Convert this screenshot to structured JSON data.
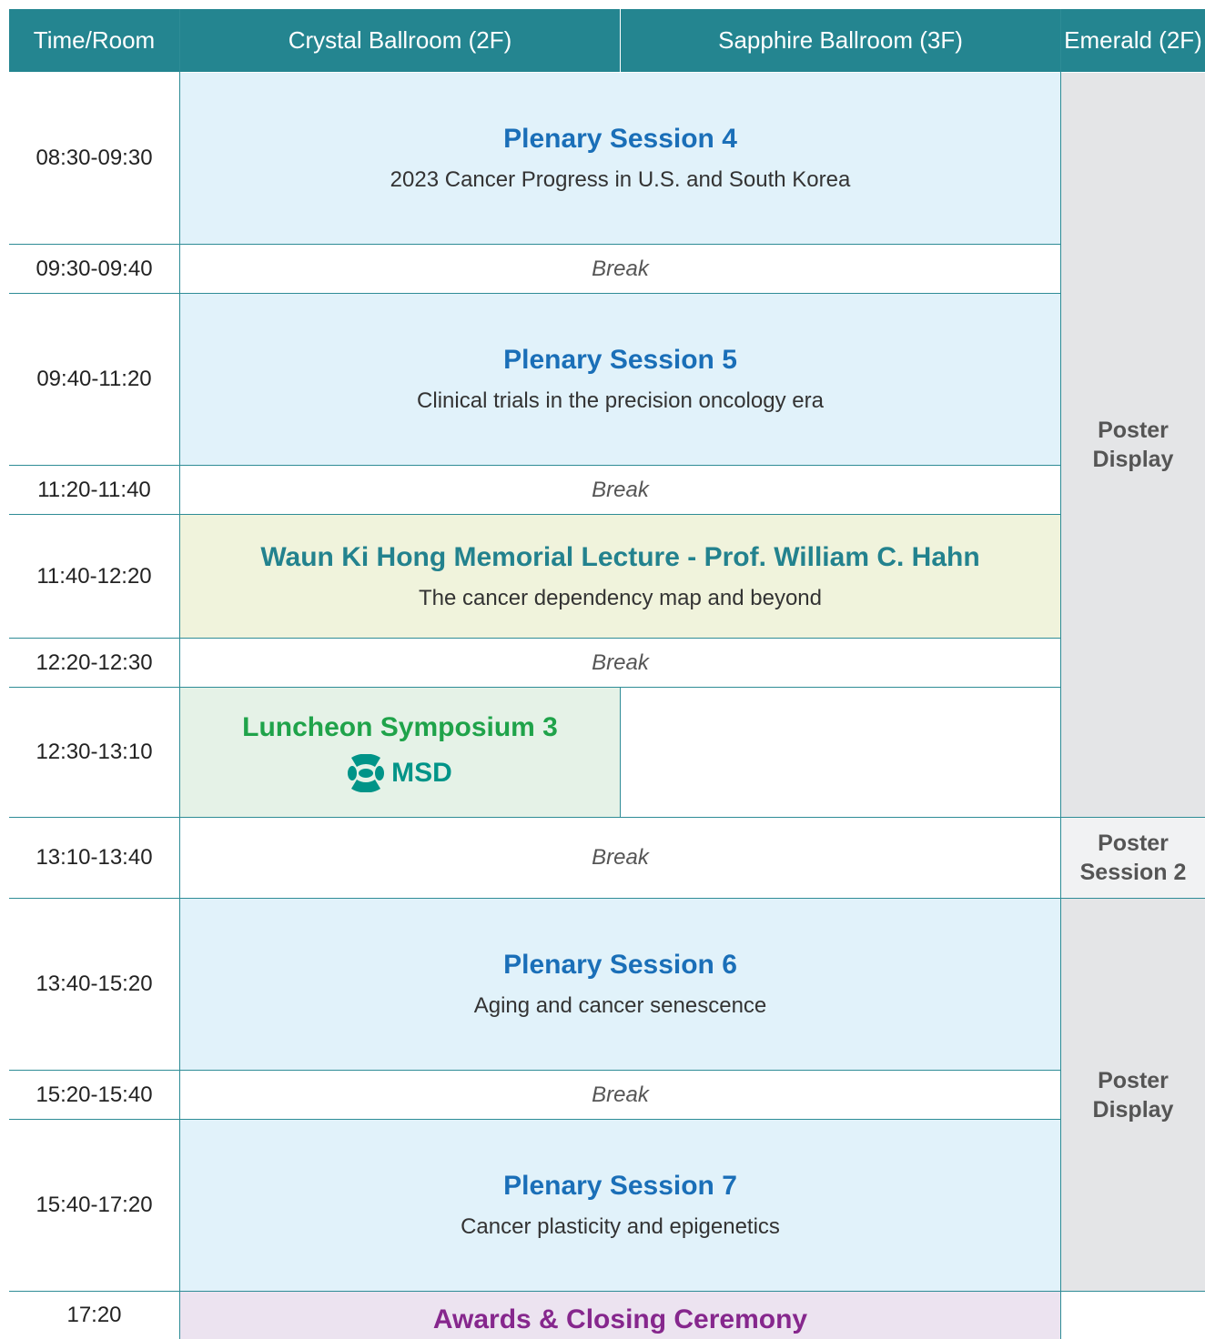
{
  "header": {
    "time_room": "Time/Room",
    "room1": "Crystal Ballroom (2F)",
    "room2": "Sapphire Ballroom (3F)",
    "room3": "Emerald (2F)"
  },
  "rows": [
    {
      "time": "08:30-09:30",
      "title": "Plenary Session 4",
      "subtitle": "2023 Cancer Progress in U.S. and South Korea"
    },
    {
      "time": "09:30-09:40",
      "label": "Break"
    },
    {
      "time": "09:40-11:20",
      "title": "Plenary Session 5",
      "subtitle": "Clinical trials in the precision oncology era"
    },
    {
      "time": "11:20-11:40",
      "label": "Break"
    },
    {
      "time": "11:40-12:20",
      "title": "Waun Ki Hong Memorial Lecture - Prof. William C. Hahn",
      "subtitle": "The cancer dependency map and beyond"
    },
    {
      "time": "12:20-12:30",
      "label": "Break"
    },
    {
      "time": "12:30-13:10",
      "title": "Luncheon Symposium 3",
      "sponsor": "MSD"
    },
    {
      "time": "13:10-13:40",
      "label": "Break"
    },
    {
      "time": "13:40-15:20",
      "title": "Plenary Session 6",
      "subtitle": "Aging and cancer senescence"
    },
    {
      "time": "15:20-15:40",
      "label": "Break"
    },
    {
      "time": "15:40-17:20",
      "title": "Plenary Session 7",
      "subtitle": "Cancer plasticity and epigenetics"
    },
    {
      "time": "17:20",
      "title": "Awards & Closing Ceremony"
    }
  ],
  "emerald": {
    "display1": [
      "Poster",
      "Display"
    ],
    "session": [
      "Poster",
      "Session 2"
    ],
    "display2": [
      "Poster",
      "Display"
    ]
  },
  "colors": {
    "header_bg": "#248590",
    "plenary_title": "#1a6fb8",
    "memorial_title": "#23828e",
    "luncheon_title": "#1fa34a",
    "ceremony_title": "#86278d",
    "msd_logo": "#009488"
  },
  "icons": {
    "sponsor_logo": "msd-logo-icon"
  }
}
